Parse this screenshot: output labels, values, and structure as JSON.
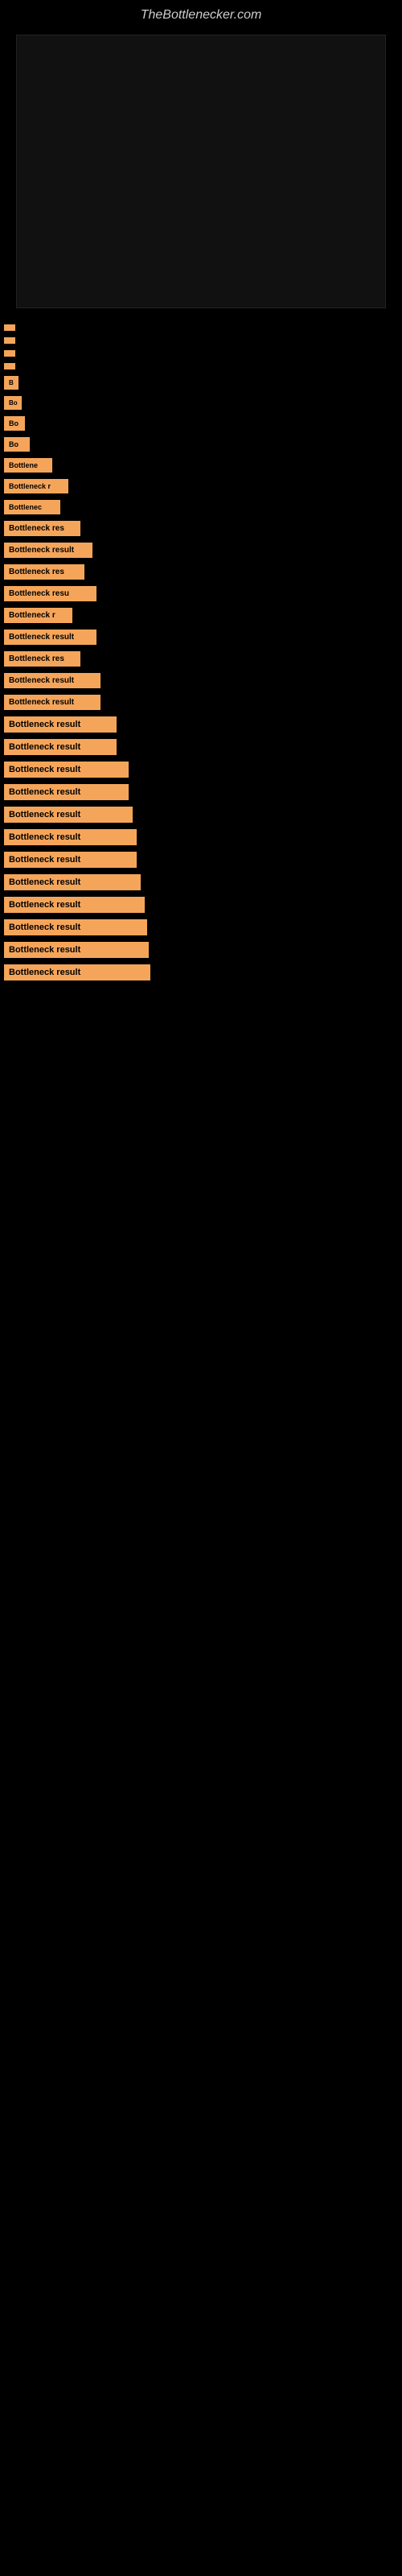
{
  "site": {
    "title": "TheBottlenecker.com"
  },
  "results": [
    {
      "id": 1,
      "label": ""
    },
    {
      "id": 2,
      "label": ""
    },
    {
      "id": 3,
      "label": ""
    },
    {
      "id": 4,
      "label": ""
    },
    {
      "id": 5,
      "label": "B"
    },
    {
      "id": 6,
      "label": "Bo"
    },
    {
      "id": 7,
      "label": "Bo"
    },
    {
      "id": 8,
      "label": "Bo"
    },
    {
      "id": 9,
      "label": "Bottlene"
    },
    {
      "id": 10,
      "label": "Bottleneck r"
    },
    {
      "id": 11,
      "label": "Bottlenec"
    },
    {
      "id": 12,
      "label": "Bottleneck res"
    },
    {
      "id": 13,
      "label": "Bottleneck result"
    },
    {
      "id": 14,
      "label": "Bottleneck res"
    },
    {
      "id": 15,
      "label": "Bottleneck resu"
    },
    {
      "id": 16,
      "label": "Bottleneck r"
    },
    {
      "id": 17,
      "label": "Bottleneck result"
    },
    {
      "id": 18,
      "label": "Bottleneck res"
    },
    {
      "id": 19,
      "label": "Bottleneck result"
    },
    {
      "id": 20,
      "label": "Bottleneck result"
    },
    {
      "id": 21,
      "label": "Bottleneck result"
    },
    {
      "id": 22,
      "label": "Bottleneck result"
    },
    {
      "id": 23,
      "label": "Bottleneck result"
    },
    {
      "id": 24,
      "label": "Bottleneck result"
    },
    {
      "id": 25,
      "label": "Bottleneck result"
    },
    {
      "id": 26,
      "label": "Bottleneck result"
    },
    {
      "id": 27,
      "label": "Bottleneck result"
    },
    {
      "id": 28,
      "label": "Bottleneck result"
    },
    {
      "id": 29,
      "label": "Bottleneck result"
    },
    {
      "id": 30,
      "label": "Bottleneck result"
    },
    {
      "id": 31,
      "label": "Bottleneck result"
    },
    {
      "id": 32,
      "label": "Bottleneck result"
    }
  ]
}
